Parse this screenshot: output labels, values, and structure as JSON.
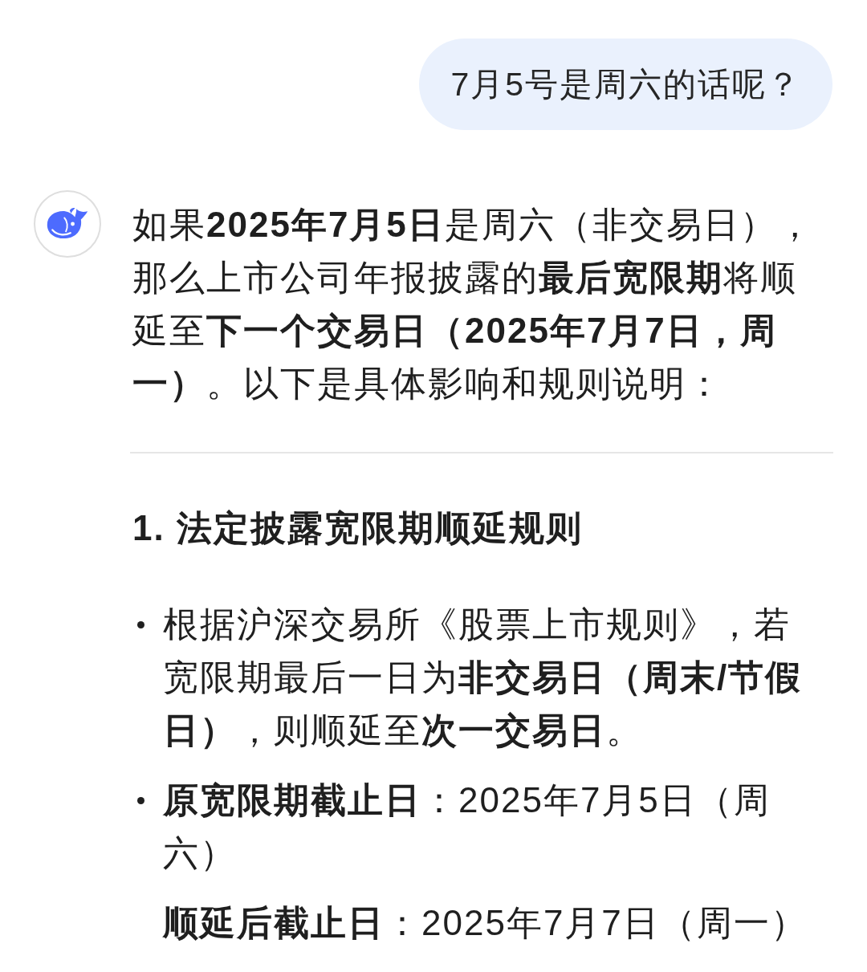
{
  "user_message": {
    "text": "7月5号是周六的话呢？"
  },
  "assistant_message": {
    "paragraph": "如果**2025年7月5日**是周六（非交易日），那么上市公司年报披露的**最后宽限期**将顺延至**下一个交易日（2025年7月7日，周一）**。以下是具体影响和规则说明：",
    "section_heading": "1. 法定披露宽限期顺延规则",
    "bullets": [
      {
        "paragraphs": [
          "根据沪深交易所《股票上市规则》，若宽限期最后一日为**非交易日（周末/节假日）**，则顺延至**次一交易日**。"
        ]
      },
      {
        "paragraphs": [
          "**原宽限期截止日**：2025年7月5日（周六）",
          "**顺延后截止日**：2025年7月7日（周一）"
        ]
      }
    ]
  }
}
